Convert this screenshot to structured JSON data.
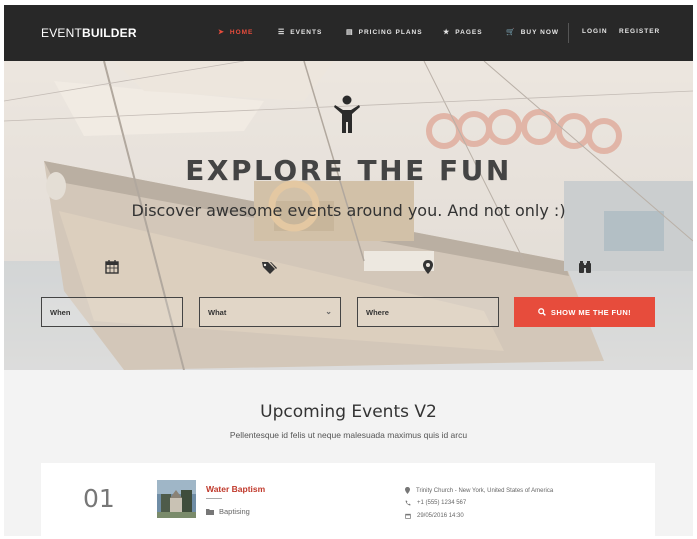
{
  "nav": {
    "logo_part1": "EVENT",
    "logo_part2": "BUILDER",
    "items": [
      {
        "label": "HOME",
        "icon": "rocket-icon"
      },
      {
        "label": "EVENTS",
        "icon": "list-icon"
      },
      {
        "label": "PRICING PLANS",
        "icon": "document-icon"
      },
      {
        "label": "PAGES",
        "icon": "star-icon"
      },
      {
        "label": "BUY NOW",
        "icon": "cart-icon"
      }
    ],
    "login": "LOGIN",
    "register": "REGISTER",
    "active_color": "#e74c3c"
  },
  "hero": {
    "title": "EXPLORE THE FUN",
    "subtitle": "Discover awesome events around you. And not only :)",
    "search": {
      "when_value": "When",
      "what_value": "What",
      "where_value": "Where",
      "button_label": "SHOW ME THE FUN!",
      "icons": [
        "calendar-icon",
        "tags-icon",
        "map-marker-icon",
        "binoculars-icon"
      ]
    },
    "accent": "#e74c3c"
  },
  "upcoming": {
    "title": "Upcoming Events V2",
    "subtitle": "Pellentesque id felis ut neque malesuada maximus quis id arcu",
    "events": [
      {
        "number": "01",
        "name": "Water Baptism",
        "category": "Baptising",
        "location": "Trinity Church - New York, United States of America",
        "phone": "+1 (555) 1234 567",
        "datetime": "29/05/2016 14:30"
      }
    ]
  }
}
